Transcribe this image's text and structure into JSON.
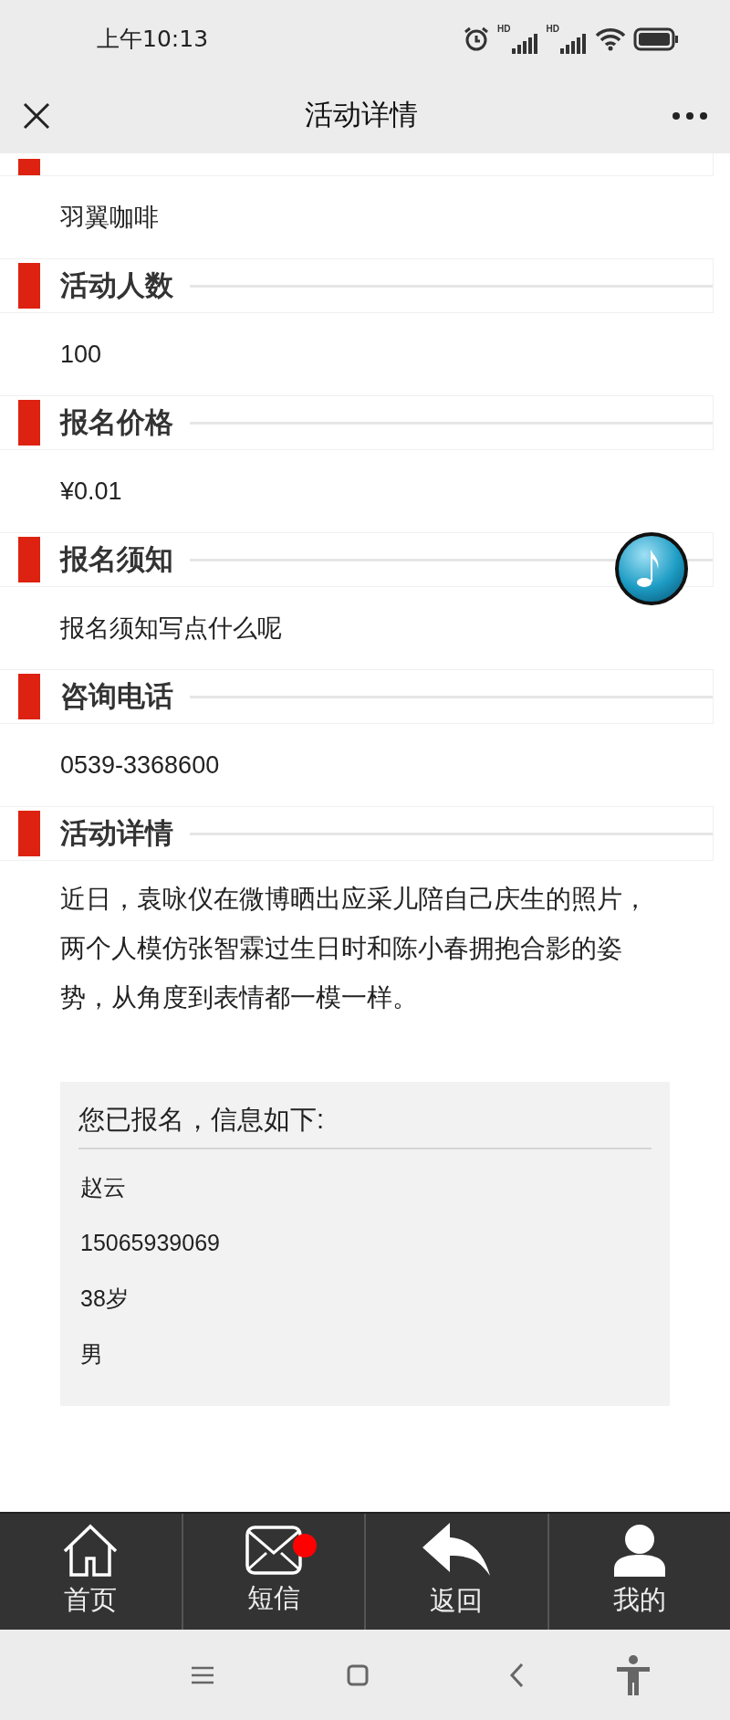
{
  "status_bar": {
    "time": "上午10:13",
    "signals": [
      "HD",
      "HD"
    ]
  },
  "header": {
    "title": "活动详情"
  },
  "sections": [
    {
      "value": "羽翼咖啡"
    },
    {
      "heading": "活动人数",
      "value": "100"
    },
    {
      "heading": "报名价格",
      "value": "¥0.01"
    },
    {
      "heading": "报名须知",
      "value": "报名须知写点什么呢"
    },
    {
      "heading": "咨询电话",
      "value": "0539-3368600"
    },
    {
      "heading": "活动详情",
      "value": "近日，袁咏仪在微博晒出应采儿陪自己庆生的照片，两个人模仿张智霖过生日时和陈小春拥抱合影的姿势，从角度到表情都一模一样。"
    }
  ],
  "registration": {
    "title": "您已报名，信息如下:",
    "items": [
      "赵云",
      "15065939069",
      "38岁",
      "男"
    ]
  },
  "tab_bar": [
    {
      "kind": "home",
      "label": "首页",
      "badge": false
    },
    {
      "kind": "mail",
      "label": "短信",
      "badge": true
    },
    {
      "kind": "back",
      "label": "返回",
      "badge": false
    },
    {
      "kind": "user",
      "label": "我的",
      "badge": false
    }
  ]
}
